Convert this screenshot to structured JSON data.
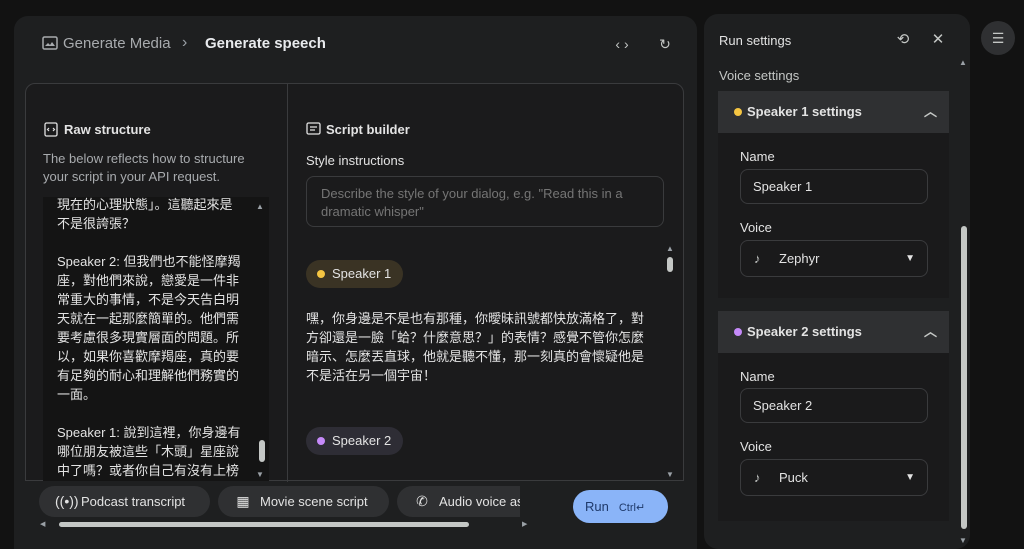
{
  "breadcrumb": {
    "parent": "Generate Media",
    "separator": "›",
    "current": "Generate speech"
  },
  "raw": {
    "title": "Raw structure",
    "description": "The below reflects how to structure your script in your API request.",
    "text": "現在的心理狀態」。這聽起來是不是很誇張？\n\nSpeaker 2: 但我們也不能怪摩羯座，對他們來說，戀愛是一件非常重大的事情，不是今天告白明天就在一起那麼簡單的。他們需要考慮很多現實層面的問題。所以，如果你喜歡摩羯座，真的要有足夠的耐心和理解他們務實的一面。\n\nSpeaker 1: 說到這裡，你身邊有哪位朋友被這些「木頭」星座說中了嗎？或者你自己有沒有上榜的感覺呢？"
  },
  "script": {
    "title": "Script builder",
    "style_label": "Style instructions",
    "style_placeholder": "Describe the style of your dialog, e.g. \"Read this in a dramatic whisper\"",
    "speaker1_chip": "Speaker 1",
    "dialog_text": "嘿，你身邊是不是也有那種，你曖昧訊號都快放滿格了，對方卻還是一臉「蛤？什麼意思？」的表情？感覺不管你怎麼暗示、怎麼丟直球，他就是聽不懂，那一刻真的會懷疑他是不是活在另一個宇宙！",
    "speaker2_chip": "Speaker 2"
  },
  "templates": [
    {
      "label": "Podcast transcript",
      "icon": "podcast-icon"
    },
    {
      "label": "Movie scene script",
      "icon": "clapperboard-icon"
    },
    {
      "label": "Audio voice assistant",
      "icon": "phone-icon"
    }
  ],
  "run": {
    "label": "Run",
    "shortcut": "Ctrl↵"
  },
  "settings": {
    "title": "Run settings",
    "voice_settings": "Voice settings",
    "speaker1": {
      "header": "Speaker 1 settings",
      "name_label": "Name",
      "name_value": "Speaker 1",
      "voice_label": "Voice",
      "voice_value": "Zephyr"
    },
    "speaker2": {
      "header": "Speaker 2 settings",
      "name_label": "Name",
      "name_value": "Speaker 2",
      "voice_label": "Voice",
      "voice_value": "Puck"
    }
  },
  "colors": {
    "speaker1_dot": "#f5c542",
    "speaker2_dot": "#c58af9",
    "run_button": "#8ab4f8"
  }
}
